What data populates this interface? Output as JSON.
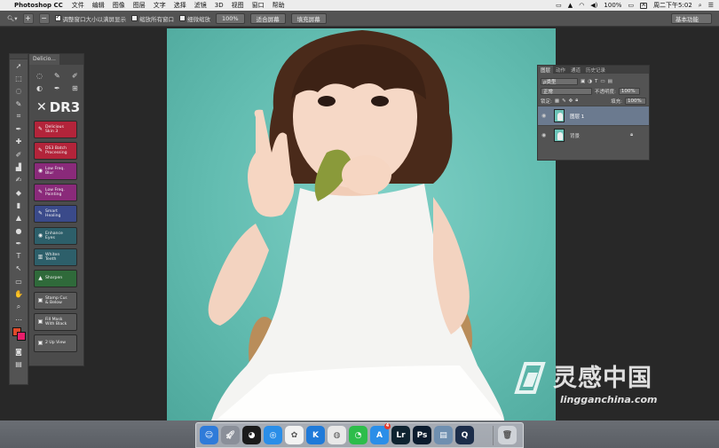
{
  "menubar": {
    "apple": "",
    "app_name": "Photoshop CC",
    "items": [
      "文件",
      "编辑",
      "图像",
      "图层",
      "文字",
      "选择",
      "滤镜",
      "3D",
      "视图",
      "窗口",
      "帮助"
    ],
    "battery": "100%",
    "input_method": "A",
    "clock": "周二下午5:02"
  },
  "options": {
    "resize_windows": "调整窗口大小以满屏显示",
    "zoom_all": "缩放所有窗口",
    "scrubby_zoom": "细微缩放",
    "zoom_level": "100%",
    "fit_screen": "适合屏幕",
    "fill_screen": "填充屏幕",
    "workspace": "基本功能"
  },
  "delicious": {
    "tab": "Delicio...",
    "logo": "DR3",
    "buttons": [
      {
        "line1": "Delicious",
        "line2": "Skin 3",
        "color": "#b3243a"
      },
      {
        "line1": "DS3 Batch",
        "line2": "Processing",
        "color": "#b3243a"
      },
      {
        "line1": "Low Freq.",
        "line2": "Blur",
        "color": "#8a2a7a"
      },
      {
        "line1": "Low Freq.",
        "line2": "Painting",
        "color": "#8a2a7a"
      },
      {
        "line1": "Smart",
        "line2": "Healing",
        "color": "#3a4a8a"
      },
      {
        "line1": "Enhance",
        "line2": "Eyes",
        "color": "#2d5f6a"
      },
      {
        "line1": "Whiten",
        "line2": "Teeth",
        "color": "#2d5f6a"
      },
      {
        "line1": "Sharpen",
        "line2": "",
        "color": "#2f6a3a"
      },
      {
        "line1": "Stamp Cur.",
        "line2": "& Below",
        "color": "#5a5a5a"
      },
      {
        "line1": "Fill Mask",
        "line2": "With Black",
        "color": "#5a5a5a"
      },
      {
        "line1": "2 Up View",
        "line2": "",
        "color": "#5a5a5a"
      }
    ]
  },
  "layers": {
    "tabs": [
      "图层",
      "动作",
      "通道",
      "历史记录"
    ],
    "filter_kind": "ρ类型",
    "blend_mode": "正常",
    "opacity_label": "不透明度:",
    "opacity": "100%",
    "lock_label": "锁定:",
    "fill_label": "填充:",
    "fill": "100%",
    "items": [
      {
        "name": "图层 1",
        "selected": true
      },
      {
        "name": "背景",
        "selected": false
      }
    ]
  },
  "dock": {
    "apps": [
      {
        "name": "finder-icon",
        "label": "",
        "color": "#2f7bd9"
      },
      {
        "name": "launchpad-icon",
        "label": "",
        "color": "#8a8f99"
      },
      {
        "name": "qq-icon",
        "label": "",
        "color": "#1a1a1a"
      },
      {
        "name": "safari-icon",
        "label": "",
        "color": "#2a8ee8"
      },
      {
        "name": "photos-icon",
        "label": "",
        "color": "#f2f2f2"
      },
      {
        "name": "kugou-icon",
        "label": "K",
        "color": "#1f7ad9"
      },
      {
        "name": "chrome-icon",
        "label": "",
        "color": "#e8e8e8"
      },
      {
        "name": "wechat-icon",
        "label": "",
        "color": "#2dbd4a"
      },
      {
        "name": "appstore-icon",
        "label": "",
        "color": "#2a8ee8",
        "badge": "4"
      },
      {
        "name": "lightroom-icon",
        "label": "Lr",
        "color": "#0e2330"
      },
      {
        "name": "photoshop-icon",
        "label": "Ps",
        "color": "#0b1b2e"
      },
      {
        "name": "preview-icon",
        "label": "",
        "color": "#6f8fb0"
      },
      {
        "name": "quicktime-icon",
        "label": "",
        "color": "#1c2d4a"
      },
      {
        "name": "trash-icon",
        "label": "",
        "color": "#cfd3d8"
      }
    ]
  },
  "watermark": {
    "cn": "灵感中国",
    "en": "lingganchina.com"
  }
}
